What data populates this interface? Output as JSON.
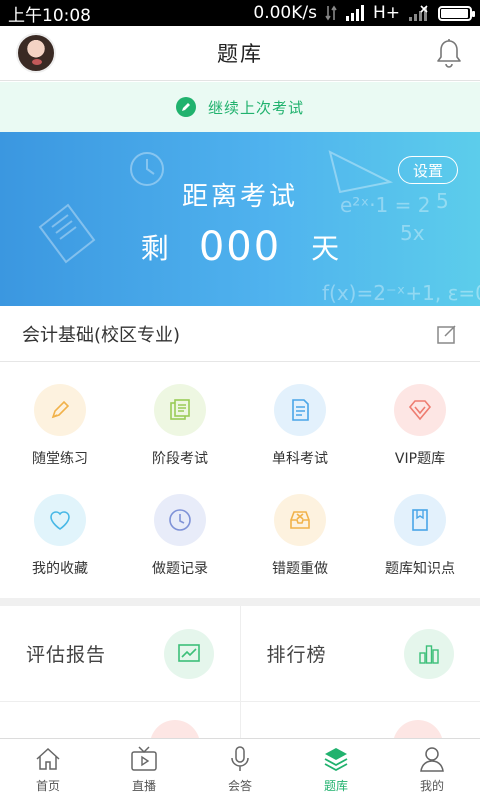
{
  "status_bar": {
    "time": "上午10:08",
    "net_speed": "0.00K/s",
    "network_type": "H+"
  },
  "header": {
    "title": "题库"
  },
  "continue_bar": {
    "label": "继续上次考试"
  },
  "banner": {
    "headline": "距离考试",
    "prefix": "剩",
    "days": "000",
    "suffix": "天",
    "settings_label": "设置"
  },
  "course": {
    "name": "会计基础(校区专业)"
  },
  "grid": {
    "items": [
      {
        "label": "随堂练习",
        "icon": "pencil-icon",
        "bg": "#fdf2df",
        "fg": "#f1b24a"
      },
      {
        "label": "阶段考试",
        "icon": "papers-icon",
        "bg": "#eef7e2",
        "fg": "#9acb57"
      },
      {
        "label": "单科考试",
        "icon": "document-icon",
        "bg": "#e3f1fc",
        "fg": "#4aa6e8"
      },
      {
        "label": "VIP题库",
        "icon": "diamond-icon",
        "bg": "#fde6e4",
        "fg": "#ee7c70"
      },
      {
        "label": "我的收藏",
        "icon": "heart-icon",
        "bg": "#e1f4fb",
        "fg": "#48b8e6"
      },
      {
        "label": "做题记录",
        "icon": "clock-icon",
        "bg": "#e8ecf9",
        "fg": "#7f92d7"
      },
      {
        "label": "错题重做",
        "icon": "inbox-x-icon",
        "bg": "#fdf2df",
        "fg": "#f1b24a"
      },
      {
        "label": "题库知识点",
        "icon": "book-icon",
        "bg": "#e3f1fc",
        "fg": "#4aa6e8"
      }
    ]
  },
  "reports": {
    "assessment_label": "评估报告",
    "ranking_label": "排行榜",
    "colors": {
      "green_bg": "#e5f6ec",
      "green_fg": "#3cbf79"
    }
  },
  "tabbar": {
    "tabs": [
      {
        "label": "首页",
        "icon": "home-icon"
      },
      {
        "label": "直播",
        "icon": "tv-icon"
      },
      {
        "label": "会答",
        "icon": "microphone-icon"
      },
      {
        "label": "题库",
        "icon": "layers-icon",
        "active": true
      },
      {
        "label": "我的",
        "icon": "user-icon"
      }
    ]
  },
  "colors": {
    "accent": "#21b26e",
    "banner_start": "#3b97e0",
    "banner_end": "#5ccdeb"
  }
}
